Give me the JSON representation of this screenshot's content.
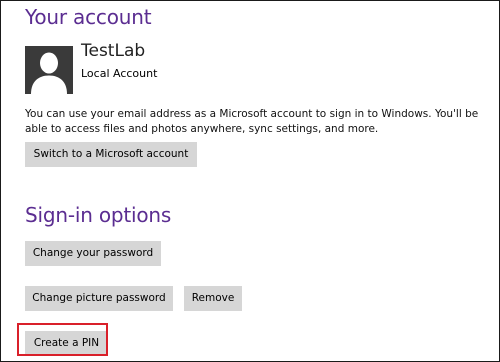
{
  "account": {
    "heading": "Your account",
    "username": "TestLab",
    "account_type": "Local Account",
    "description": "You can use your email address as a Microsoft account to sign in to Windows. You'll be able to access files and photos anywhere, sync settings, and more.",
    "switch_button": "Switch to a Microsoft account",
    "avatar_icon": "user-silhouette-icon"
  },
  "signin": {
    "heading": "Sign-in options",
    "change_password": "Change your password",
    "change_picture_password": "Change picture password",
    "remove": "Remove",
    "create_pin": "Create a PIN"
  },
  "colors": {
    "heading": "#5b2d91",
    "button": "#d6d6d6",
    "highlight": "#d9202a",
    "avatar_bg": "#3a3a3a"
  }
}
